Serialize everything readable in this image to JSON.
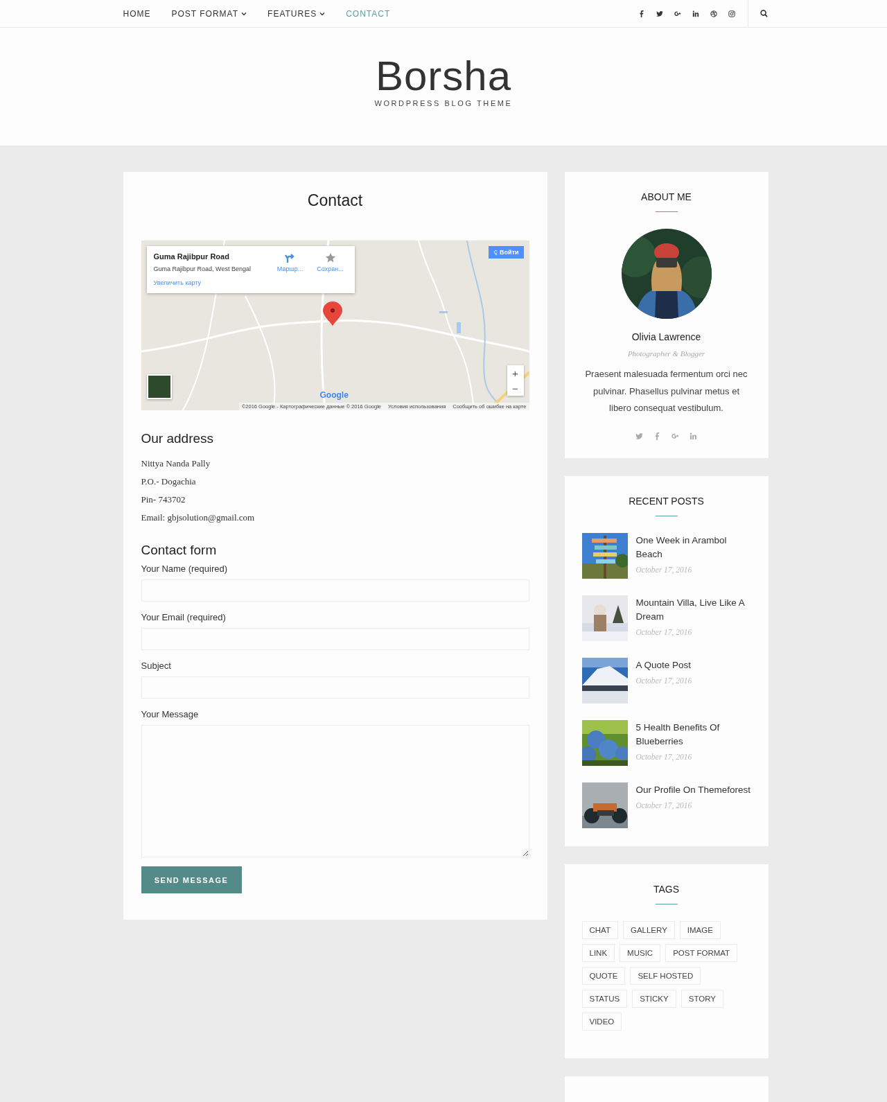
{
  "nav": {
    "items": [
      {
        "label": "HOME",
        "selected": false,
        "has_dropdown": false
      },
      {
        "label": "POST FORMAT",
        "selected": false,
        "has_dropdown": true
      },
      {
        "label": "FEATURES",
        "selected": false,
        "has_dropdown": true
      },
      {
        "label": "CONTACT",
        "selected": true,
        "has_dropdown": false
      }
    ],
    "social": [
      {
        "kind": "facebook"
      },
      {
        "kind": "twitter"
      },
      {
        "kind": "google-plus"
      },
      {
        "kind": "linkedin"
      },
      {
        "kind": "dribbble"
      },
      {
        "kind": "instagram"
      }
    ]
  },
  "header": {
    "title": "Borsha",
    "tagline": "WORDPRESS BLOG THEME"
  },
  "page": {
    "title": "Contact",
    "map": {
      "info": {
        "title": "Guma Rajibpur Road",
        "address": "Guma Rajibpur Road, West Bengal",
        "actions": [
          {
            "kind": "directions",
            "label": "Маршр..."
          },
          {
            "kind": "save",
            "label": "Сохран..."
          }
        ],
        "link": "Увеличить карту"
      },
      "signin": "Войти",
      "zoom": [
        "+",
        "−"
      ],
      "logo": "Google",
      "attribution": [
        "©2016 Google - Картографические данные © 2016 Google",
        "Условия использования",
        "Сообщить об ошибке на карте"
      ]
    },
    "address": {
      "heading": "Our address",
      "lines": [
        "Nittya Nanda Pally",
        "P.O.- Dogachia",
        "Pin- 743702",
        "Email: gbjsolution@gmail.com"
      ]
    },
    "form": {
      "heading": "Contact form",
      "fields": [
        {
          "label": "Your Name (required)",
          "kind": "text"
        },
        {
          "label": "Your Email (required)",
          "kind": "text"
        },
        {
          "label": "Subject",
          "kind": "text"
        },
        {
          "label": "Your Message",
          "kind": "textarea"
        }
      ],
      "submit": "SEND MESSAGE"
    }
  },
  "sidebar": {
    "about": {
      "title": "ABOUT ME",
      "name": "Olivia Lawrence",
      "role": "Photographer & Blogger",
      "bio": "Praesent malesuada fermentum orci nec pulvinar. Phasellus pulvinar metus et libero consequat vestibulum.",
      "social": [
        {
          "kind": "twitter"
        },
        {
          "kind": "facebook"
        },
        {
          "kind": "google-plus"
        },
        {
          "kind": "linkedin"
        }
      ]
    },
    "recent": {
      "title": "RECENT POSTS",
      "posts": [
        {
          "title": "One Week in Arambol Beach",
          "date": "October 17, 2016"
        },
        {
          "title": "Mountain Villa, Live Like A Dream",
          "date": "October 17, 2016"
        },
        {
          "title": "A Quote Post",
          "date": "October 17, 2016"
        },
        {
          "title": "5 Health Benefits Of Blueberries",
          "date": "October 17, 2016"
        },
        {
          "title": "Our Profile On Themeforest",
          "date": "October 17, 2016"
        }
      ]
    },
    "tags": {
      "title": "TAGS",
      "items": [
        "CHAT",
        "GALLERY",
        "IMAGE",
        "LINK",
        "MUSIC",
        "POST FORMAT",
        "QUOTE",
        "SELF HOSTED",
        "STATUS",
        "STICKY",
        "STORY",
        "VIDEO"
      ]
    }
  }
}
